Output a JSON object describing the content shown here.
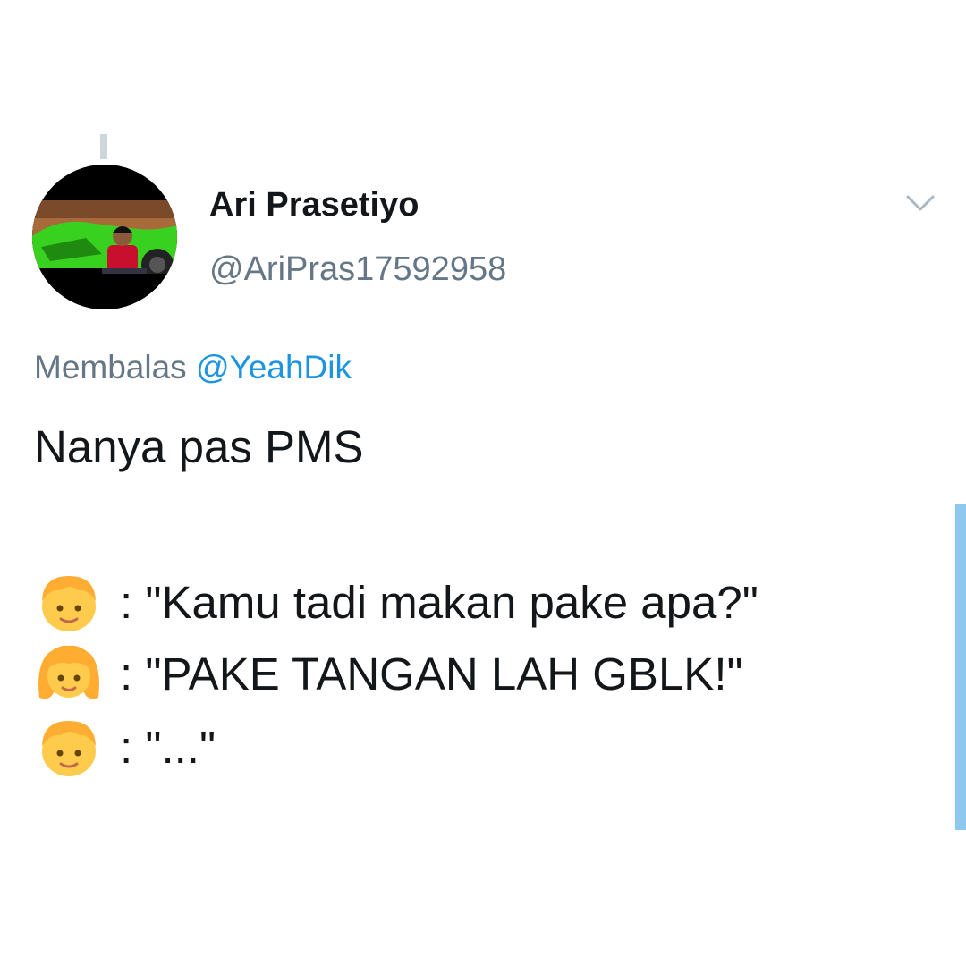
{
  "tweet": {
    "display_name": "Ari Prasetiyo",
    "handle": "@AriPras17592958",
    "reply_prefix": "Membalas",
    "reply_mention": "@YeahDik",
    "text": "Nanya pas PMS",
    "dialog": [
      {
        "speaker_icon": "boy-emoji-icon",
        "text": ": \"Kamu tadi makan pake apa?\""
      },
      {
        "speaker_icon": "girl-emoji-icon",
        "text": ": \"PAKE TANGAN LAH GBLK!\""
      },
      {
        "speaker_icon": "boy-emoji-icon",
        "text": ": \"...\""
      }
    ]
  },
  "colors": {
    "text_primary": "#14171a",
    "text_secondary": "#657786",
    "link": "#1b95e0",
    "scroll_indicator": "#8fc8ef",
    "emoji_skin": "#ffcb4c",
    "emoji_hair": "#ffac33"
  }
}
